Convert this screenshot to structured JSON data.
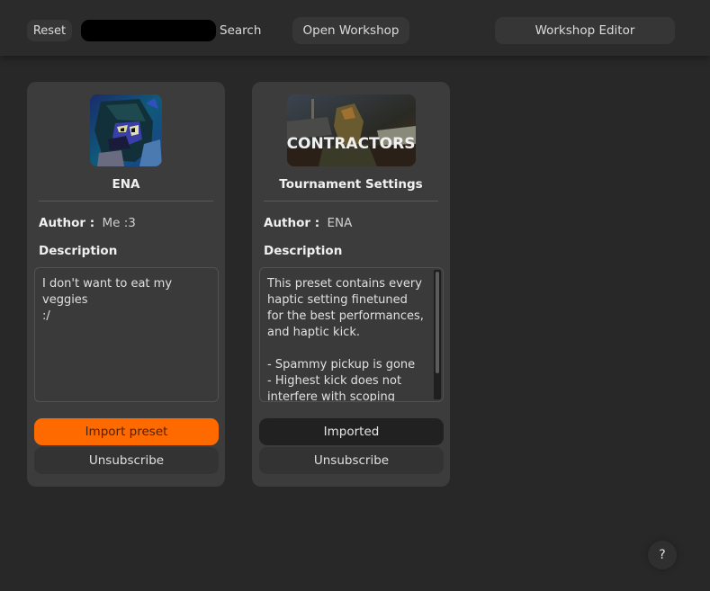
{
  "topbar": {
    "reset_label": "Reset",
    "search_value": "",
    "search_label": "Search",
    "open_workshop_label": "Open Workshop",
    "workshop_editor_label": "Workshop Editor"
  },
  "presets": [
    {
      "title": "ENA",
      "author_label": "Author :",
      "author": "Me :3",
      "description_label": "Description",
      "description": "I don't want to eat my\nveggies\n:/",
      "thumbnail": "ena-avatar-image",
      "primary_button_label": "Import preset",
      "primary_state": "import",
      "unsubscribe_label": "Unsubscribe"
    },
    {
      "title": "Tournament Settings",
      "author_label": "Author :",
      "author": "ENA",
      "description_label": "Description",
      "description": "This preset contains every\nhaptic setting finetuned\nfor the best performances,\nand haptic kick.\n\n- Spammy pickup is gone\n- Highest kick does not\ninterfere with scoping",
      "thumbnail": "contractors-game-image",
      "thumbnail_text": "CONTRACTORS",
      "primary_button_label": "Imported",
      "primary_state": "imported",
      "unsubscribe_label": "Unsubscribe"
    }
  ],
  "help": {
    "label": "?"
  },
  "colors": {
    "accent": "#ff6a00",
    "background": "#282828",
    "card": "#3c3c3c",
    "topbar": "#2b2b2b"
  }
}
